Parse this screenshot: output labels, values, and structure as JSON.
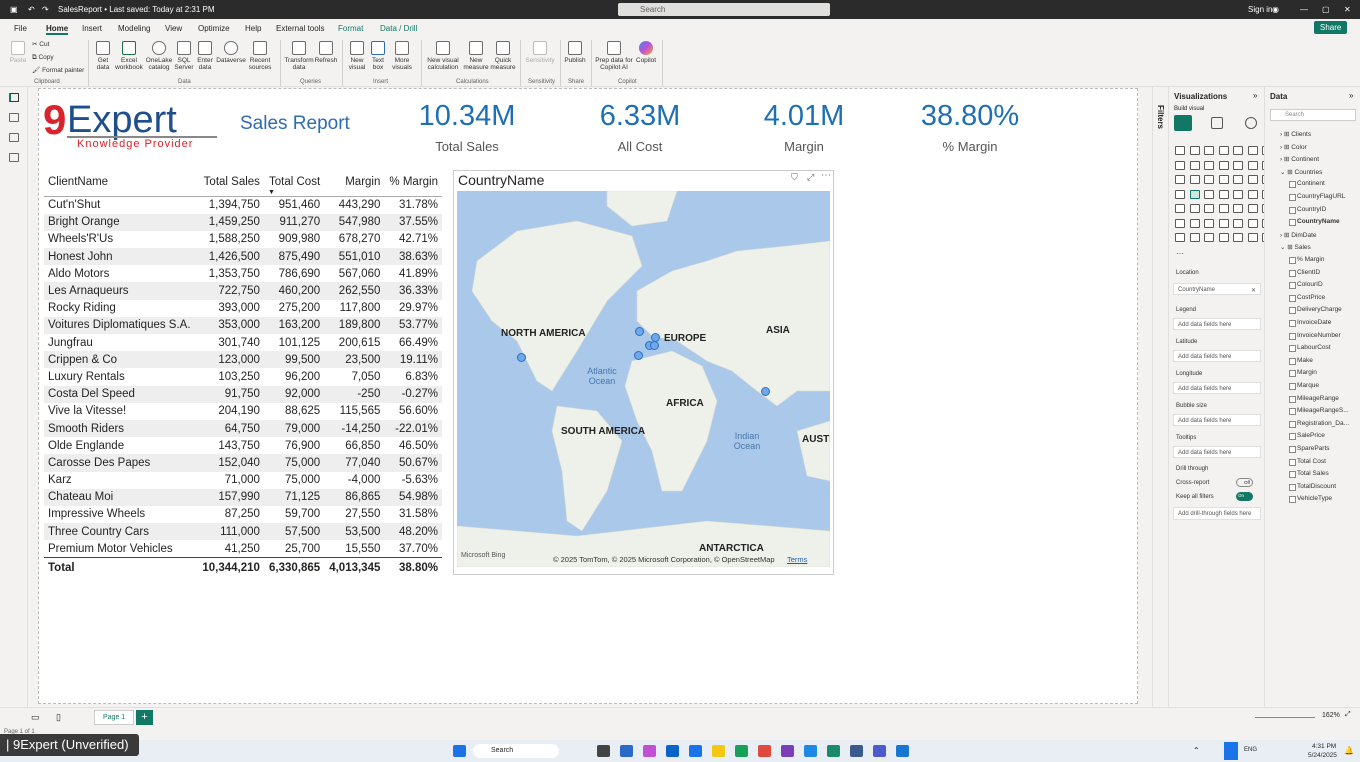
{
  "titlebar": {
    "file_title": "SalesReport • Last saved: Today at 2:31 PM",
    "search": "Search",
    "signin": "Sign in"
  },
  "menu": [
    "File",
    "Home",
    "Insert",
    "Modeling",
    "View",
    "Optimize",
    "Help",
    "External tools",
    "Format",
    "Data / Drill"
  ],
  "share": "Share",
  "ribbon": {
    "clipboard": {
      "paste": "Paste",
      "cut": "Cut",
      "copy": "Copy",
      "format_painter": "Format painter",
      "group": "Clipboard"
    },
    "data": {
      "get_data": "Get data",
      "excel": "Excel workbook",
      "onelake": "OneLake catalog",
      "sql": "SQL Server",
      "enter": "Enter data",
      "dataverse": "Dataverse",
      "recent": "Recent sources",
      "group": "Data"
    },
    "queries": {
      "transform": "Transform data",
      "refresh": "Refresh",
      "group": "Queries"
    },
    "insert": {
      "new_visual": "New visual",
      "text_box": "Text box",
      "more_visuals": "More visuals",
      "group": "Insert"
    },
    "calc": {
      "new_visual_calc": "New visual calculation",
      "new_measure": "New measure",
      "quick_measure": "Quick measure",
      "group": "Calculations"
    },
    "sensitivity": {
      "label": "Sensitivity",
      "group": "Sensitivity"
    },
    "share": {
      "publish": "Publish",
      "group": "Share"
    },
    "copilot": {
      "prep": "Prep data for Copilot AI",
      "copilot": "Copilot",
      "group": "Copilot"
    }
  },
  "report": {
    "title": "Sales Report",
    "logo_text": "9Expert",
    "logo_sub": "Knowledge Provider",
    "kpis": [
      {
        "value": "10.34M",
        "label": "Total Sales"
      },
      {
        "value": "6.33M",
        "label": "All Cost"
      },
      {
        "value": "4.01M",
        "label": "Margin"
      },
      {
        "value": "38.80%",
        "label": "% Margin"
      }
    ],
    "table": {
      "headers": [
        "ClientName",
        "Total Sales",
        "Total Cost",
        "Margin",
        "% Margin"
      ],
      "rows": [
        [
          "Cut'n'Shut",
          "1,394,750",
          "951,460",
          "443,290",
          "31.78%"
        ],
        [
          "Bright Orange",
          "1,459,250",
          "911,270",
          "547,980",
          "37.55%"
        ],
        [
          "Wheels'R'Us",
          "1,588,250",
          "909,980",
          "678,270",
          "42.71%"
        ],
        [
          "Honest John",
          "1,426,500",
          "875,490",
          "551,010",
          "38.63%"
        ],
        [
          "Aldo Motors",
          "1,353,750",
          "786,690",
          "567,060",
          "41.89%"
        ],
        [
          "Les Arnaqueurs",
          "722,750",
          "460,200",
          "262,550",
          "36.33%"
        ],
        [
          "Rocky Riding",
          "393,000",
          "275,200",
          "117,800",
          "29.97%"
        ],
        [
          "Voitures Diplomatiques S.A.",
          "353,000",
          "163,200",
          "189,800",
          "53.77%"
        ],
        [
          "Jungfrau",
          "301,740",
          "101,125",
          "200,615",
          "66.49%"
        ],
        [
          "Crippen & Co",
          "123,000",
          "99,500",
          "23,500",
          "19.11%"
        ],
        [
          "Luxury Rentals",
          "103,250",
          "96,200",
          "7,050",
          "6.83%"
        ],
        [
          "Costa Del Speed",
          "91,750",
          "92,000",
          "-250",
          "-0.27%"
        ],
        [
          "Vive la Vitesse!",
          "204,190",
          "88,625",
          "115,565",
          "56.60%"
        ],
        [
          "Smooth Riders",
          "64,750",
          "79,000",
          "-14,250",
          "-22.01%"
        ],
        [
          "Olde Englande",
          "143,750",
          "76,900",
          "66,850",
          "46.50%"
        ],
        [
          "Carosse Des Papes",
          "152,040",
          "75,000",
          "77,040",
          "50.67%"
        ],
        [
          "Karz",
          "71,000",
          "75,000",
          "-4,000",
          "-5.63%"
        ],
        [
          "Chateau Moi",
          "157,990",
          "71,125",
          "86,865",
          "54.98%"
        ],
        [
          "Impressive Wheels",
          "87,250",
          "59,700",
          "27,550",
          "31.58%"
        ],
        [
          "Three Country Cars",
          "111,000",
          "57,500",
          "53,500",
          "48.20%"
        ],
        [
          "Premium Motor Vehicles",
          "41,250",
          "25,700",
          "15,550",
          "37.70%"
        ]
      ],
      "total": [
        "Total",
        "10,344,210",
        "6,330,865",
        "4,013,345",
        "38.80%"
      ]
    },
    "map": {
      "title": "CountryName",
      "labels": [
        "NORTH AMERICA",
        "EUROPE",
        "ASIA",
        "AFRICA",
        "SOUTH AMERICA",
        "AUSTI",
        "ANTARCTICA"
      ],
      "oceans": [
        "Atlantic Ocean",
        "Indian Ocean"
      ],
      "attribution": "© 2025 TomTom, © 2025 Microsoft Corporation, © OpenStreetMap",
      "terms": "Terms",
      "bing": "Microsoft Bing"
    }
  },
  "viz_pane": {
    "title": "Visualizations",
    "build": "Build visual",
    "location": "Location",
    "location_value": "CountryName",
    "legend": "Legend",
    "latitude": "Latitude",
    "longitude": "Longitude",
    "bubble_size": "Bubble size",
    "tooltips": "Tooltips",
    "drill": "Drill through",
    "cross_report": "Cross-report",
    "cross_state": "Off",
    "keep_filters": "Keep all filters",
    "keep_state": "On",
    "add": "Add data fields here",
    "add_drill": "Add drill-through fields here",
    "filters": "Filters"
  },
  "data_pane": {
    "title": "Data",
    "search": "Search",
    "tables": [
      "Clients",
      "Color",
      "Continent",
      "Countries"
    ],
    "countries_fields": [
      "Continent",
      "CountryFlagURL",
      "CountryID",
      "CountryName"
    ],
    "tables2": [
      "DimDate",
      "Sales"
    ],
    "sales_fields": [
      "% Margin",
      "ClientID",
      "ColourID",
      "CostPrice",
      "DeliveryCharge",
      "InvoiceDate",
      "InvoiceNumber",
      "LabourCost",
      "Make",
      "Margin",
      "Marque",
      "MileageRange",
      "MileageRangeS...",
      "Registration_Da...",
      "SalePrice",
      "SpareParts",
      "Total Cost",
      "Total Sales",
      "TotalDiscount",
      "VehicleType"
    ]
  },
  "pagebar": {
    "page": "Page 1",
    "zoom": "162%",
    "status": "Page 1 of 1"
  },
  "taskbar": {
    "search": "Search",
    "lang": "ENG",
    "time": "4:31 PM",
    "date": "5/24/2025"
  },
  "watermark": "| 9Expert (Unverified)"
}
